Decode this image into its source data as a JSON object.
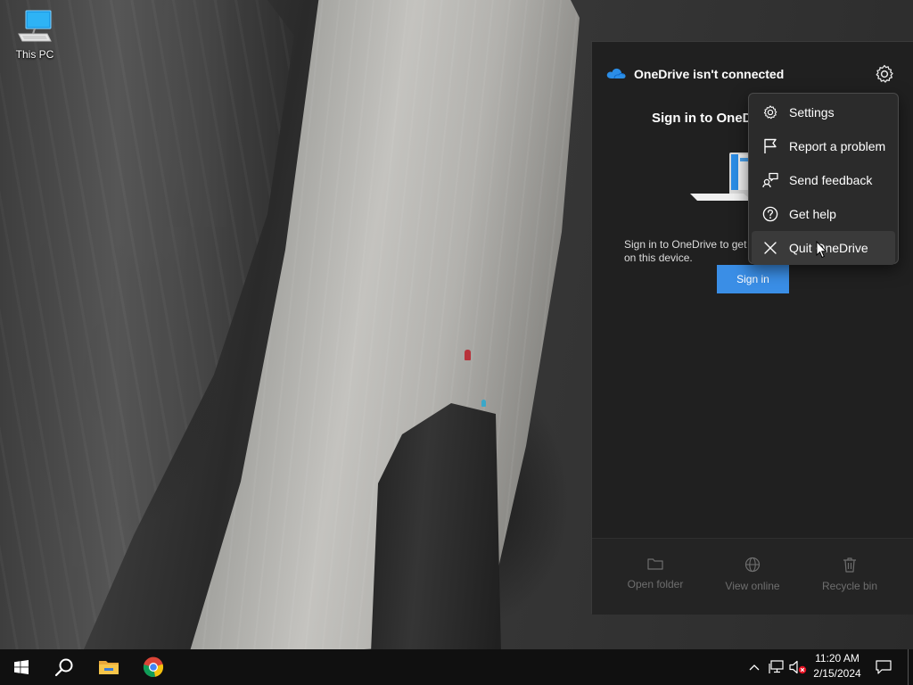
{
  "desktop": {
    "icons": [
      {
        "label": "This PC",
        "icon": "this-pc-icon"
      }
    ]
  },
  "onedrive": {
    "header_title": "OneDrive isn't connected",
    "signin_heading": "Sign in to OneD",
    "signin_description": "Sign in to OneDrive to get\non this device.",
    "signin_button": "Sign in",
    "footer": [
      {
        "label": "Open folder",
        "icon": "folder-icon"
      },
      {
        "label": "View online",
        "icon": "globe-icon"
      },
      {
        "label": "Recycle bin",
        "icon": "recycle-bin-icon"
      }
    ],
    "accent_color": "#3a8ee6"
  },
  "settings_menu": {
    "items": [
      {
        "label": "Settings",
        "icon": "gear-icon"
      },
      {
        "label": "Report a problem",
        "icon": "flag-icon"
      },
      {
        "label": "Send feedback",
        "icon": "feedback-icon"
      },
      {
        "label": "Get help",
        "icon": "help-icon"
      },
      {
        "label": "Quit OneDrive",
        "icon": "close-icon"
      }
    ],
    "hovered_item": "Quit OneDrive"
  },
  "taskbar": {
    "pinned": [
      {
        "name": "start",
        "icon": "windows-logo-icon"
      },
      {
        "name": "search",
        "icon": "search-icon"
      },
      {
        "name": "file-explorer",
        "icon": "folder-icon"
      },
      {
        "name": "chrome",
        "icon": "chrome-icon"
      }
    ],
    "tray": {
      "icons": [
        "chevron-up-icon",
        "network-icon",
        "volume-muted-icon"
      ],
      "time": "11:20 AM",
      "date": "2/15/2024"
    }
  }
}
